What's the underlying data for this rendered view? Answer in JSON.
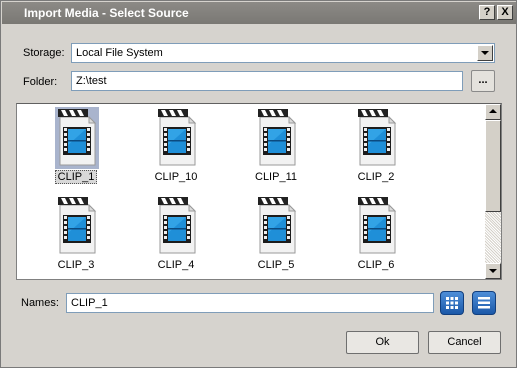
{
  "window": {
    "title": "Import Media - Select Source",
    "help_label": "?",
    "close_label": "X"
  },
  "storage": {
    "label": "Storage:",
    "value": "Local File System"
  },
  "folder": {
    "label": "Folder:",
    "value": "Z:\\test",
    "browse_label": "..."
  },
  "files": [
    {
      "name": "CLIP_1",
      "selected": true
    },
    {
      "name": "CLIP_10",
      "selected": false
    },
    {
      "name": "CLIP_11",
      "selected": false
    },
    {
      "name": "CLIP_2",
      "selected": false
    },
    {
      "name": "CLIP_3",
      "selected": false
    },
    {
      "name": "CLIP_4",
      "selected": false
    },
    {
      "name": "CLIP_5",
      "selected": false
    },
    {
      "name": "CLIP_6",
      "selected": false
    }
  ],
  "names": {
    "label": "Names:",
    "value": "CLIP_1"
  },
  "buttons": {
    "ok": "Ok",
    "cancel": "Cancel"
  },
  "icons": {
    "file": "video-clip-icon",
    "grid_view": "grid-view-icon",
    "list_view": "list-view-icon"
  },
  "colors": {
    "title_bar": "#7f7d79",
    "selection": "#9aa7c4",
    "view_button": "#1f5fb0"
  }
}
